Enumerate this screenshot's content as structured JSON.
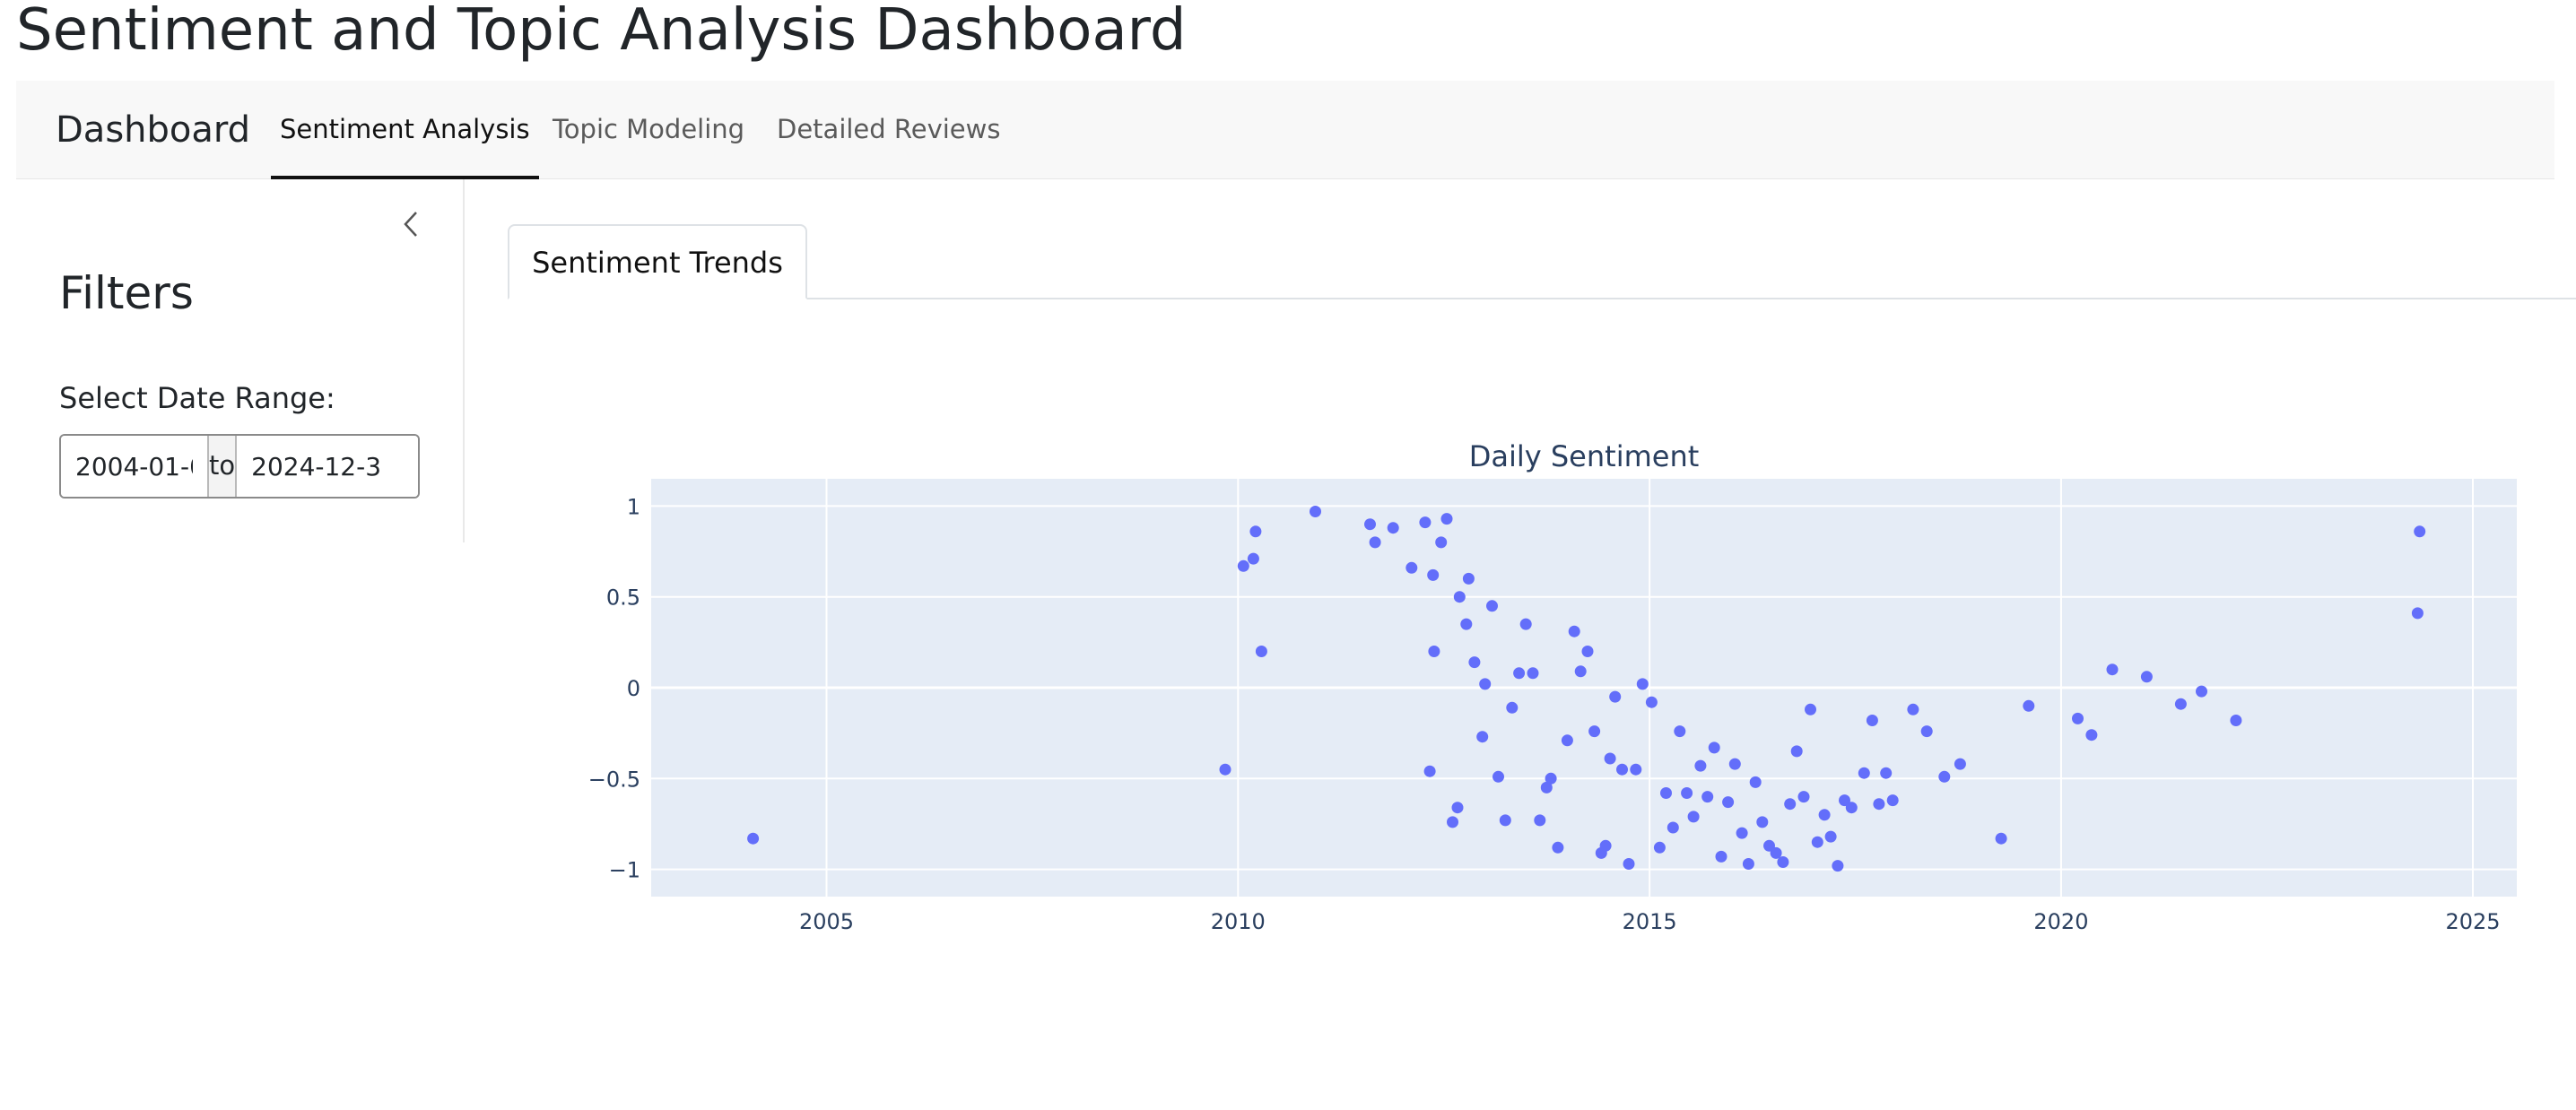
{
  "page": {
    "title": "Sentiment and Topic Analysis Dashboard"
  },
  "navbar": {
    "brand": "Dashboard",
    "tabs": [
      {
        "label": "Sentiment Analysis",
        "active": true
      },
      {
        "label": "Topic Modeling",
        "active": false
      },
      {
        "label": "Detailed Reviews",
        "active": false
      }
    ]
  },
  "sidebar": {
    "collapse_icon": "chevron-left-icon",
    "title": "Filters",
    "date_range_label": "Select Date Range:",
    "start_date": "2004-01-0",
    "separator": "to",
    "end_date": "2024-12-3"
  },
  "content_tabs": [
    {
      "label": "Sentiment Trends",
      "active": true
    }
  ],
  "colors": {
    "marker": "#636efa",
    "plot_bg": "#e5ecf6",
    "grid": "#ffffff",
    "axis_text": "#2a3f5f"
  },
  "chart_data": {
    "type": "scatter",
    "title": "Daily Sentiment",
    "xlabel": "",
    "ylabel": "",
    "x_is_date": true,
    "xlim": [
      "2002-11-15",
      "2025-07-15"
    ],
    "ylim": [
      -1.15,
      1.15
    ],
    "x_ticks": [
      {
        "value": "2005-01-01",
        "label": "2005"
      },
      {
        "value": "2010-01-01",
        "label": "2010"
      },
      {
        "value": "2015-01-01",
        "label": "2015"
      },
      {
        "value": "2020-01-01",
        "label": "2020"
      },
      {
        "value": "2025-01-01",
        "label": "2025"
      }
    ],
    "y_ticks": [
      {
        "value": 1,
        "label": "1"
      },
      {
        "value": 0.5,
        "label": "0.5"
      },
      {
        "value": 0,
        "label": "0"
      },
      {
        "value": -0.5,
        "label": "−0.5"
      },
      {
        "value": -1,
        "label": "−1"
      }
    ],
    "grid": true,
    "legend": "none",
    "series": [
      {
        "points": [
          [
            "2004-02-10",
            -0.83
          ],
          [
            "2009-11-05",
            -0.45
          ],
          [
            "2010-01-25",
            0.67
          ],
          [
            "2010-03-10",
            0.71
          ],
          [
            "2010-03-20",
            0.86
          ],
          [
            "2010-04-15",
            0.2
          ],
          [
            "2010-12-10",
            0.97
          ],
          [
            "2011-08-10",
            0.9
          ],
          [
            "2011-09-01",
            0.8
          ],
          [
            "2011-11-20",
            0.88
          ],
          [
            "2012-02-10",
            0.66
          ],
          [
            "2012-04-10",
            0.91
          ],
          [
            "2012-05-15",
            0.62
          ],
          [
            "2012-05-20",
            0.2
          ],
          [
            "2012-05-01",
            -0.46
          ],
          [
            "2012-08-10",
            -0.74
          ],
          [
            "2012-09-01",
            -0.66
          ],
          [
            "2012-06-20",
            0.8
          ],
          [
            "2012-07-15",
            0.93
          ],
          [
            "2012-09-10",
            0.5
          ],
          [
            "2012-10-10",
            0.35
          ],
          [
            "2012-10-20",
            0.6
          ],
          [
            "2012-11-15",
            0.14
          ],
          [
            "2012-12-20",
            -0.27
          ],
          [
            "2013-01-01",
            0.02
          ],
          [
            "2013-02-01",
            0.45
          ],
          [
            "2013-03-01",
            -0.49
          ],
          [
            "2013-04-01",
            -0.73
          ],
          [
            "2013-05-01",
            -0.11
          ],
          [
            "2013-06-01",
            0.08
          ],
          [
            "2013-07-01",
            0.35
          ],
          [
            "2013-08-01",
            0.08
          ],
          [
            "2013-09-01",
            -0.73
          ],
          [
            "2013-10-01",
            -0.55
          ],
          [
            "2013-10-20",
            -0.5
          ],
          [
            "2013-11-20",
            -0.88
          ],
          [
            "2014-01-01",
            -0.29
          ],
          [
            "2014-02-01",
            0.31
          ],
          [
            "2014-03-01",
            0.09
          ],
          [
            "2014-04-01",
            0.2
          ],
          [
            "2014-05-01",
            -0.24
          ],
          [
            "2014-06-01",
            -0.91
          ],
          [
            "2014-06-20",
            -0.87
          ],
          [
            "2014-07-10",
            -0.39
          ],
          [
            "2014-08-01",
            -0.05
          ],
          [
            "2014-09-01",
            -0.45
          ],
          [
            "2014-10-01",
            -0.97
          ],
          [
            "2014-11-01",
            -0.45
          ],
          [
            "2014-12-01",
            0.02
          ],
          [
            "2015-01-10",
            -0.08
          ],
          [
            "2015-02-15",
            -0.88
          ],
          [
            "2015-03-15",
            -0.58
          ],
          [
            "2015-04-15",
            -0.77
          ],
          [
            "2015-05-15",
            -0.24
          ],
          [
            "2015-06-15",
            -0.58
          ],
          [
            "2015-07-15",
            -0.71
          ],
          [
            "2015-08-15",
            -0.43
          ],
          [
            "2015-09-15",
            -0.6
          ],
          [
            "2015-10-15",
            -0.33
          ],
          [
            "2015-11-15",
            -0.93
          ],
          [
            "2015-12-15",
            -0.63
          ],
          [
            "2016-01-15",
            -0.42
          ],
          [
            "2016-02-15",
            -0.8
          ],
          [
            "2016-03-15",
            -0.97
          ],
          [
            "2016-04-15",
            -0.52
          ],
          [
            "2016-05-15",
            -0.74
          ],
          [
            "2016-06-15",
            -0.87
          ],
          [
            "2016-07-15",
            -0.91
          ],
          [
            "2016-08-15",
            -0.96
          ],
          [
            "2016-09-15",
            -0.64
          ],
          [
            "2016-10-15",
            -0.35
          ],
          [
            "2016-11-15",
            -0.6
          ],
          [
            "2016-12-15",
            -0.12
          ],
          [
            "2017-01-15",
            -0.85
          ],
          [
            "2017-02-15",
            -0.7
          ],
          [
            "2017-03-15",
            -0.82
          ],
          [
            "2017-04-15",
            -0.98
          ],
          [
            "2017-05-15",
            -0.62
          ],
          [
            "2017-06-15",
            -0.66
          ],
          [
            "2017-08-10",
            -0.47
          ],
          [
            "2017-09-15",
            -0.18
          ],
          [
            "2017-10-15",
            -0.64
          ],
          [
            "2017-11-15",
            -0.47
          ],
          [
            "2017-12-15",
            -0.62
          ],
          [
            "2018-03-15",
            -0.12
          ],
          [
            "2018-05-15",
            -0.24
          ],
          [
            "2018-08-01",
            -0.49
          ],
          [
            "2018-10-10",
            -0.42
          ],
          [
            "2019-04-10",
            -0.83
          ],
          [
            "2019-08-10",
            -0.1
          ],
          [
            "2020-03-15",
            -0.17
          ],
          [
            "2020-05-15",
            -0.26
          ],
          [
            "2020-08-15",
            0.1
          ],
          [
            "2021-01-15",
            0.06
          ],
          [
            "2021-06-15",
            -0.09
          ],
          [
            "2021-09-15",
            -0.02
          ],
          [
            "2022-02-15",
            -0.18
          ],
          [
            "2024-05-01",
            0.41
          ],
          [
            "2024-05-10",
            0.86
          ]
        ]
      }
    ]
  }
}
